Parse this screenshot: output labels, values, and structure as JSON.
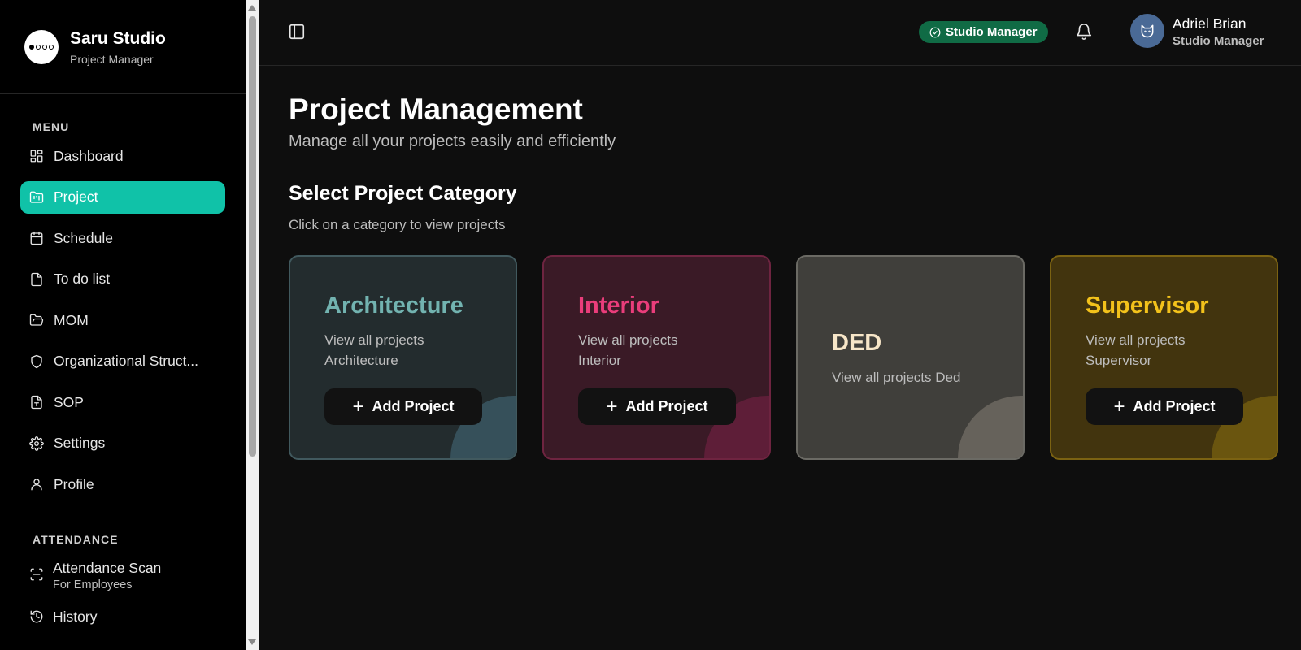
{
  "brand": {
    "name": "Saru Studio",
    "subtitle": "Project Manager"
  },
  "sidebar": {
    "menu_label": "MENU",
    "items": [
      {
        "label": "Dashboard",
        "icon": "dashboard-icon"
      },
      {
        "label": "Project",
        "icon": "folder-kanban-icon",
        "active": true
      },
      {
        "label": "Schedule",
        "icon": "calendar-icon"
      },
      {
        "label": "To do list",
        "icon": "file-icon"
      },
      {
        "label": "MOM",
        "icon": "folder-open-icon"
      },
      {
        "label": "Organizational Struct...",
        "icon": "shield-icon"
      },
      {
        "label": "SOP",
        "icon": "file-text-icon"
      },
      {
        "label": "Settings",
        "icon": "gear-icon"
      },
      {
        "label": "Profile",
        "icon": "user-icon"
      }
    ],
    "attendance_label": "ATTENDANCE",
    "attendance_items": [
      {
        "label": "Attendance Scan",
        "sub": "For Employees",
        "icon": "scan-icon"
      },
      {
        "label": "History",
        "icon": "history-icon"
      }
    ]
  },
  "topbar": {
    "role_badge": "Studio Manager",
    "user": {
      "name": "Adriel Brian",
      "role": "Studio Manager"
    }
  },
  "main": {
    "title": "Project Management",
    "subtitle": "Manage all your projects easily and efficiently",
    "section_title": "Select Project Category",
    "section_subtitle": "Click on a category to view projects",
    "cards": [
      {
        "title": "Architecture",
        "desc_line1": "View all projects",
        "desc_line2": "Architecture",
        "button": "Add Project"
      },
      {
        "title": "Interior",
        "desc_line1": "View all projects",
        "desc_line2": "Interior",
        "button": "Add Project"
      },
      {
        "title": "DED",
        "desc": "View all projects Ded"
      },
      {
        "title": "Supervisor",
        "desc_line1": "View all projects",
        "desc_line2": "Supervisor",
        "button": "Add Project"
      }
    ]
  },
  "colors": {
    "accent": "#10c2a8",
    "badge": "#106b45",
    "architecture": "#72b3b0",
    "interior": "#ea3d7b",
    "ded": "#f7e6c8",
    "supervisor": "#f3c21b"
  }
}
